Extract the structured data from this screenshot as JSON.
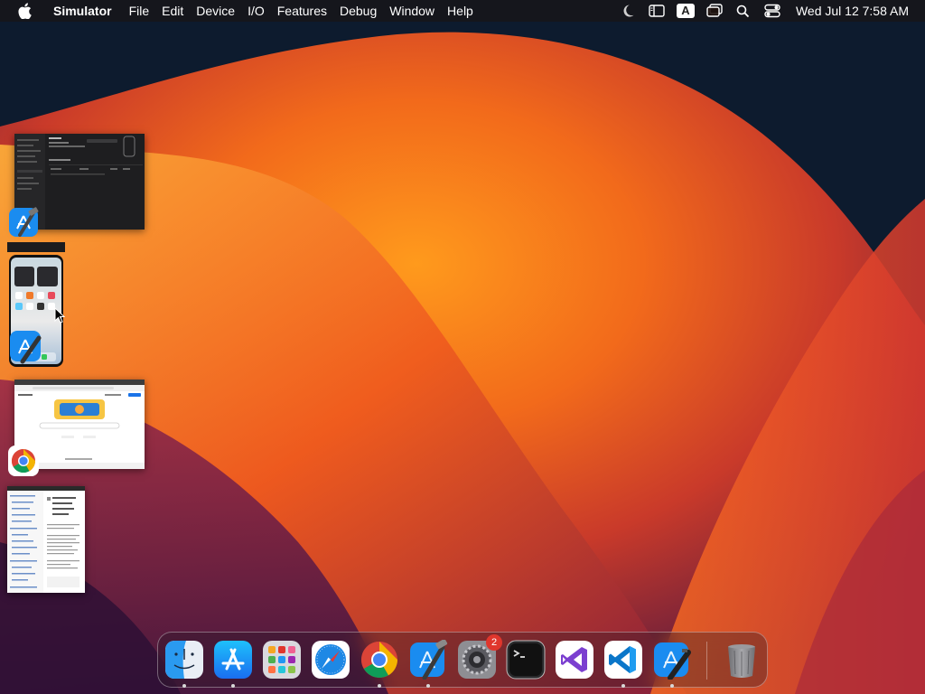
{
  "menubar": {
    "app_name": "Simulator",
    "menus": [
      "File",
      "Edit",
      "Device",
      "I/O",
      "Features",
      "Debug",
      "Window",
      "Help"
    ],
    "status_icons": [
      "moon-icon",
      "sidebar-icon",
      "input-source-icon",
      "window-stack-icon",
      "search-icon",
      "control-center-icon"
    ],
    "input_source": "A",
    "clock": "Wed Jul 12  7:58 AM"
  },
  "windows": [
    {
      "app": "Xcode",
      "icon": "xcode-icon"
    },
    {
      "app": "Simulator",
      "icon": "simulator-icon"
    },
    {
      "app": "Google Chrome",
      "icon": "chrome-icon"
    },
    {
      "app": "Document",
      "icon": "document-icon"
    }
  ],
  "dock": {
    "items": [
      {
        "name": "Finder",
        "icon": "finder-icon",
        "running": true
      },
      {
        "name": "App Store",
        "icon": "app-store-icon",
        "running": true
      },
      {
        "name": "Launchpad",
        "icon": "launchpad-icon",
        "running": false
      },
      {
        "name": "Safari",
        "icon": "safari-icon",
        "running": false
      },
      {
        "name": "Google Chrome",
        "icon": "chrome-icon",
        "running": true
      },
      {
        "name": "Xcode",
        "icon": "xcode-icon",
        "running": true
      },
      {
        "name": "System Settings",
        "icon": "settings-icon",
        "running": false,
        "badge": "2"
      },
      {
        "name": "Terminal",
        "icon": "terminal-icon",
        "running": false
      },
      {
        "name": "Visual Studio",
        "icon": "visual-studio-icon",
        "running": false
      },
      {
        "name": "Visual Studio Code",
        "icon": "vscode-icon",
        "running": true
      },
      {
        "name": "Simulator",
        "icon": "simulator-icon",
        "running": true
      },
      {
        "name": "Trash",
        "icon": "trash-icon",
        "running": false
      }
    ]
  },
  "colors": {
    "badge": "#e0362c",
    "wallpaper_orange": "#f26a1b",
    "wallpaper_dark": "#0d1b2e"
  }
}
